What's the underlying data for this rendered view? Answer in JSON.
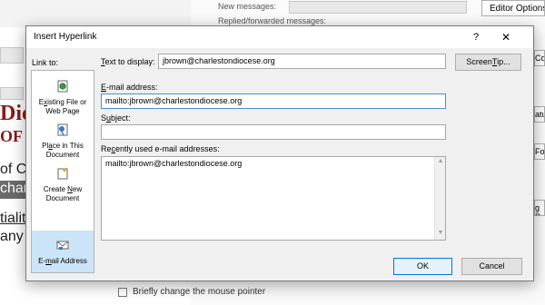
{
  "background": {
    "options_rows": [
      "New messages:",
      "Replied/forwarded messages:"
    ],
    "editor_options_button": "Editor Options",
    "right_clips": [
      "Correc",
      "ature",
      "Font",
      "g Pan"
    ],
    "doc_fragments": [
      "Dio",
      "OF C",
      "of C",
      "char",
      "tiality",
      "any"
    ],
    "bottom_checkbox_label": "Briefly change the mouse pointer"
  },
  "dialog": {
    "title": "Insert Hyperlink",
    "help_glyph": "?",
    "close_glyph": "✕",
    "link_to_label": "Link to:",
    "link_to_items": [
      {
        "label_html": "E<u>x</u>isting File or Web Page",
        "icon": "web-page-icon"
      },
      {
        "label_html": "Pl<u>a</u>ce in This Document",
        "icon": "place-in-document-icon"
      },
      {
        "label_html": "Create <u>N</u>ew Document",
        "icon": "new-document-icon"
      },
      {
        "label_html": "E-<u>m</u>ail Address",
        "icon": "email-address-icon",
        "selected": true
      }
    ],
    "text_to_display_label": "Text to display:",
    "text_to_display_value": "jbrown@charlestondiocese.org",
    "screentip_button": "ScreenTip...",
    "email_address_label": "E-mail address:",
    "email_address_value": "mailto:jbrown@charlestondiocese.org",
    "subject_label": "Subject:",
    "subject_value": "",
    "recent_label": "Recently used e-mail addresses:",
    "recent_items": [
      "mailto:jbrown@charlestondiocese.org"
    ],
    "ok_button": "OK",
    "cancel_button": "Cancel"
  },
  "colors": {
    "selection": "#cce4f7",
    "accent": "#0078d7",
    "doc_red": "#8b1a1a"
  }
}
